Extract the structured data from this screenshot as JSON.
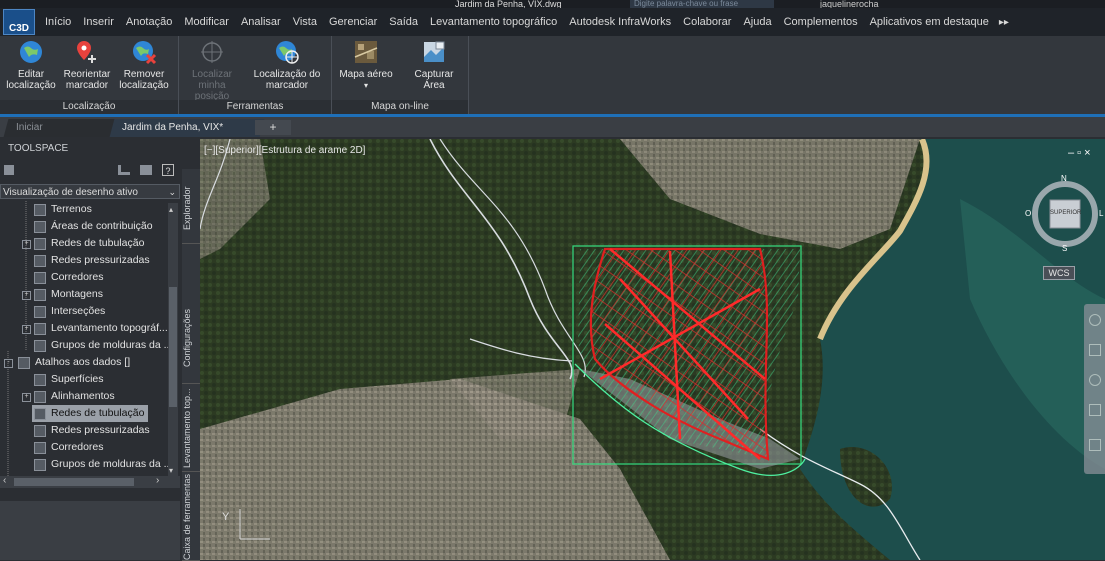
{
  "titlebar": {
    "document_title": "Jardim da Penha, VIX.dwg",
    "search_placeholder": "Digite palavra-chave ou frase",
    "user": "jaquelinerocha"
  },
  "app": {
    "logo_text": "C3D"
  },
  "menu": {
    "items": [
      "Início",
      "Inserir",
      "Anotação",
      "Modificar",
      "Analisar",
      "Vista",
      "Gerenciar",
      "Saída",
      "Levantamento topográfico",
      "Autodesk InfraWorks",
      "Colaborar",
      "Ajuda",
      "Complementos",
      "Aplicativos em destaque"
    ],
    "more": "▸▸"
  },
  "ribbon": {
    "groups": [
      {
        "label": "Localização",
        "buttons": [
          {
            "label1": "Editar",
            "label2": "localização",
            "icon": "globe-edit-icon",
            "enabled": true
          },
          {
            "label1": "Reorientar",
            "label2": "marcador",
            "icon": "marker-reorient-icon",
            "enabled": true
          },
          {
            "label1": "Remover",
            "label2": "localização",
            "icon": "globe-remove-icon",
            "enabled": true
          }
        ]
      },
      {
        "label": "Ferramentas",
        "buttons": [
          {
            "label1": "Localizar",
            "label2": "minha posição",
            "icon": "crosshair-icon",
            "enabled": false
          },
          {
            "label1": "Localização do",
            "label2": "marcador",
            "icon": "globe-marker-icon",
            "enabled": true
          }
        ]
      },
      {
        "label": "Mapa on-line",
        "buttons": [
          {
            "label1": "Mapa aéreo",
            "label2": "",
            "icon": "aerial-map-icon",
            "enabled": true
          },
          {
            "label1": "Capturar",
            "label2": "Área",
            "icon": "capture-area-icon",
            "enabled": true
          }
        ]
      }
    ]
  },
  "tabs": {
    "start": "Iniciar",
    "drawing": "Jardim da Penha, VIX*",
    "add": "+"
  },
  "toolspace": {
    "title": "TOOLSPACE",
    "dropdown": "Visualização de desenho ativo",
    "tree": [
      {
        "label": "Terrenos",
        "indent": 1
      },
      {
        "label": "Áreas de contribuição",
        "indent": 1
      },
      {
        "label": "Redes de tubulação",
        "indent": 1,
        "expander": "+"
      },
      {
        "label": "Redes pressurizadas",
        "indent": 1
      },
      {
        "label": "Corredores",
        "indent": 1
      },
      {
        "label": "Montagens",
        "indent": 1,
        "expander": "+"
      },
      {
        "label": "Interseções",
        "indent": 1
      },
      {
        "label": "Levantamento topográf...",
        "indent": 1,
        "expander": "+"
      },
      {
        "label": "Grupos de molduras da ...",
        "indent": 1
      },
      {
        "label": "Atalhos aos dados []",
        "indent": 0,
        "expander": "-"
      },
      {
        "label": "Superfícies",
        "indent": 1
      },
      {
        "label": "Alinhamentos",
        "indent": 1,
        "expander": "+"
      },
      {
        "label": "Redes de tubulação",
        "indent": 1,
        "selected": true
      },
      {
        "label": "Redes pressurizadas",
        "indent": 1
      },
      {
        "label": "Corredores",
        "indent": 1
      },
      {
        "label": "Grupos de molduras da ...",
        "indent": 1
      }
    ],
    "side_tabs": [
      "Explorador",
      "Configurações",
      "Levantamento top...",
      "Caixa de ferramentas"
    ]
  },
  "viewport": {
    "label": "[−][Superior][Estrutura de arame 2D]",
    "viewcube_face": "SUPERIOR",
    "compass": {
      "n": "N",
      "s": "S",
      "e": "L",
      "w": "O"
    },
    "wcs": "WCS",
    "win_controls": "– ▫ ×",
    "axis_label": "Y"
  },
  "colors": {
    "ribbon_bg": "#33373d",
    "accent": "#1e6fb8",
    "network_red": "#e02020",
    "boundary_green": "#35d17a"
  }
}
